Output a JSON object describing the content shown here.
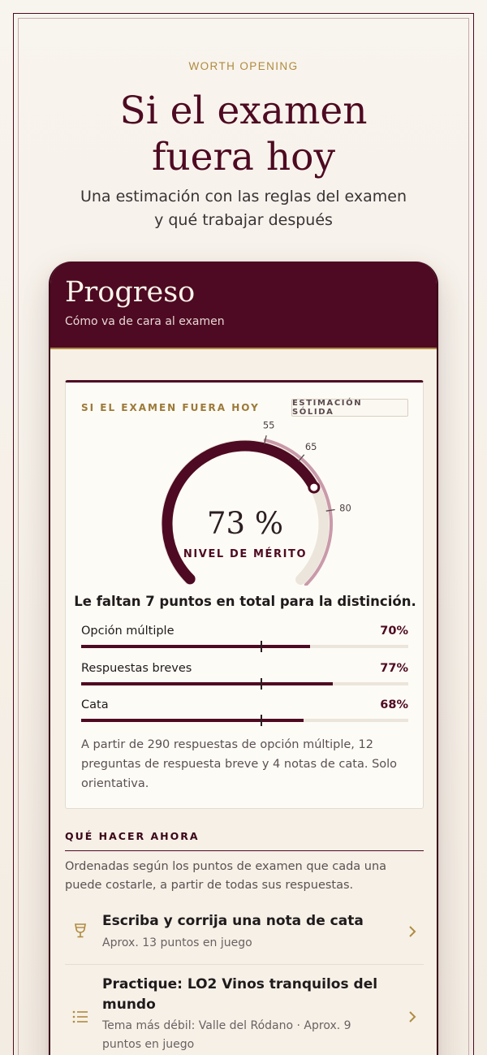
{
  "hero": {
    "eyebrow": "WORTH  OPENING",
    "title_line1": "Si el examen",
    "title_line2": "fuera hoy",
    "subtitle_line1": "Una estimación con las reglas del examen",
    "subtitle_line2": "y qué trabajar después"
  },
  "header": {
    "title": "Progreso",
    "subtitle": "Cómo va de cara al examen"
  },
  "estimate_card": {
    "eyebrow": "SI EL EXAMEN FUERA HOY",
    "badge": "ESTIMACIÓN SÓLIDA",
    "gauge": {
      "value": 73,
      "value_text": "73 %",
      "label": "NIVEL DE MÉRITO",
      "markers": [
        {
          "value": 55,
          "label": "55"
        },
        {
          "value": 65,
          "label": "65"
        },
        {
          "value": 80,
          "label": "80"
        }
      ]
    },
    "gap_text": "Le faltan 7 puntos en total para la distinción.",
    "metrics": [
      {
        "label": "Opción múltiple",
        "value_text": "70%",
        "value": 70,
        "target": 55
      },
      {
        "label": "Respuestas breves",
        "value_text": "77%",
        "value": 77,
        "target": 55
      },
      {
        "label": "Cata",
        "value_text": "68%",
        "value": 68,
        "target": 55
      }
    ],
    "note": "A partir de 290 respuestas de opción múltiple, 12 preguntas de respuesta breve y 4 notas de cata. Solo orientativa."
  },
  "next_steps": {
    "heading": "QUÉ HACER AHORA",
    "description": "Ordenadas según los puntos de examen que cada una puede costarle, a partir de todas sus respuestas.",
    "items": [
      {
        "icon": "wine-glass-icon",
        "title": "Escriba y corrija una nota de cata",
        "subtitle": "Aprox. 13 puntos en juego"
      },
      {
        "icon": "list-icon",
        "title": "Practique: LO2 Vinos tranquilos del mundo",
        "subtitle": "Tema más débil: Valle del Ródano · Aprox. 9 puntos en juego"
      }
    ]
  },
  "colors": {
    "burgundy": "#4e0a22",
    "gold": "#b08a3e",
    "track": "#ebe5db",
    "pink_arc": "#c99aaa"
  }
}
